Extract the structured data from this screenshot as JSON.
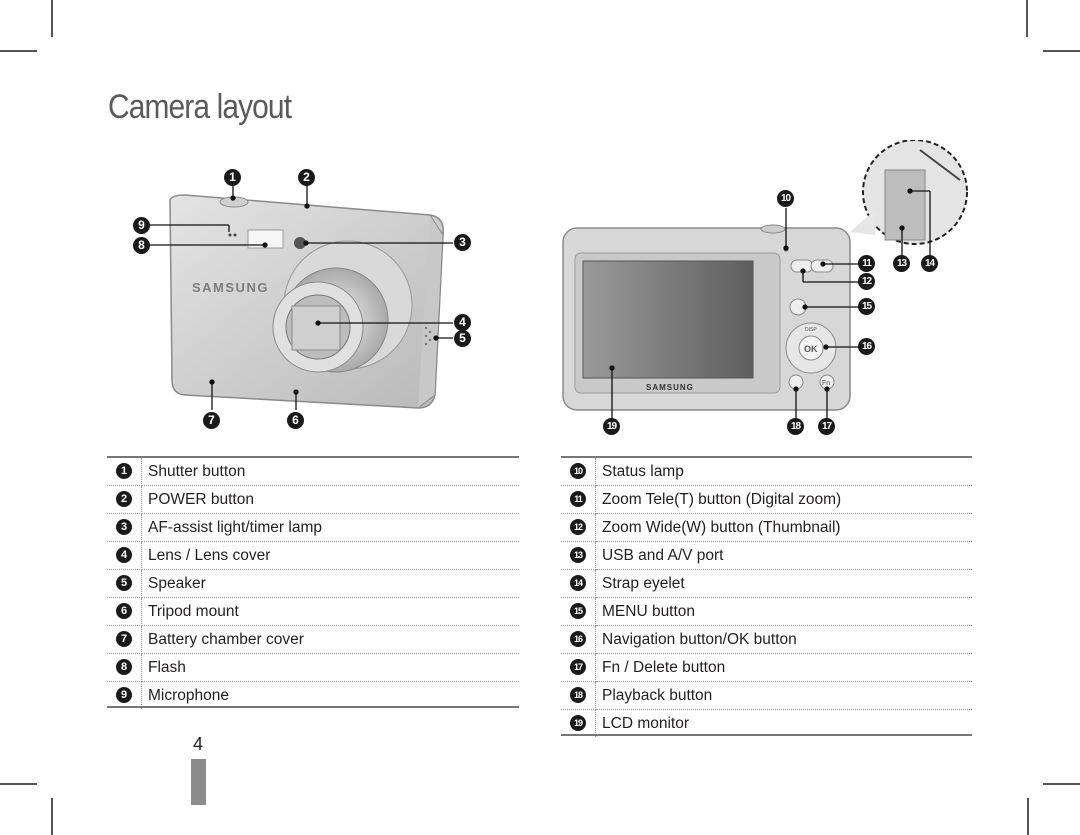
{
  "page": {
    "title": "Camera layout",
    "page_number": "4"
  },
  "front_view": {
    "brand": "SAMSUNG",
    "callouts": [
      "1",
      "2",
      "3",
      "4",
      "5",
      "6",
      "7",
      "8",
      "9"
    ]
  },
  "back_view": {
    "brand": "SAMSUNG",
    "button_labels": {
      "ok": "OK",
      "disp": "DISP",
      "fn": "Fn",
      "menu": "MENU"
    },
    "callouts": [
      "10",
      "11",
      "12",
      "13",
      "14",
      "15",
      "16",
      "17",
      "18",
      "19"
    ]
  },
  "front_parts": [
    {
      "num": "1",
      "label": "Shutter button"
    },
    {
      "num": "2",
      "label": "POWER button"
    },
    {
      "num": "3",
      "label": "AF-assist light/timer lamp"
    },
    {
      "num": "4",
      "label": "Lens / Lens cover"
    },
    {
      "num": "5",
      "label": "Speaker"
    },
    {
      "num": "6",
      "label": "Tripod mount"
    },
    {
      "num": "7",
      "label": "Battery chamber cover"
    },
    {
      "num": "8",
      "label": "Flash"
    },
    {
      "num": "9",
      "label": "Microphone"
    }
  ],
  "back_parts": [
    {
      "num": "10",
      "label": "Status lamp"
    },
    {
      "num": "11",
      "label": "Zoom Tele(T) button (Digital zoom)"
    },
    {
      "num": "12",
      "label": "Zoom Wide(W) button (Thumbnail)"
    },
    {
      "num": "13",
      "label": "USB and A/V port"
    },
    {
      "num": "14",
      "label": "Strap eyelet"
    },
    {
      "num": "15",
      "label": "MENU button"
    },
    {
      "num": "16",
      "label": "Navigation button/OK button"
    },
    {
      "num": "17",
      "label": "Fn / Delete button"
    },
    {
      "num": "18",
      "label": "Playback button"
    },
    {
      "num": "19",
      "label": "LCD monitor"
    }
  ]
}
